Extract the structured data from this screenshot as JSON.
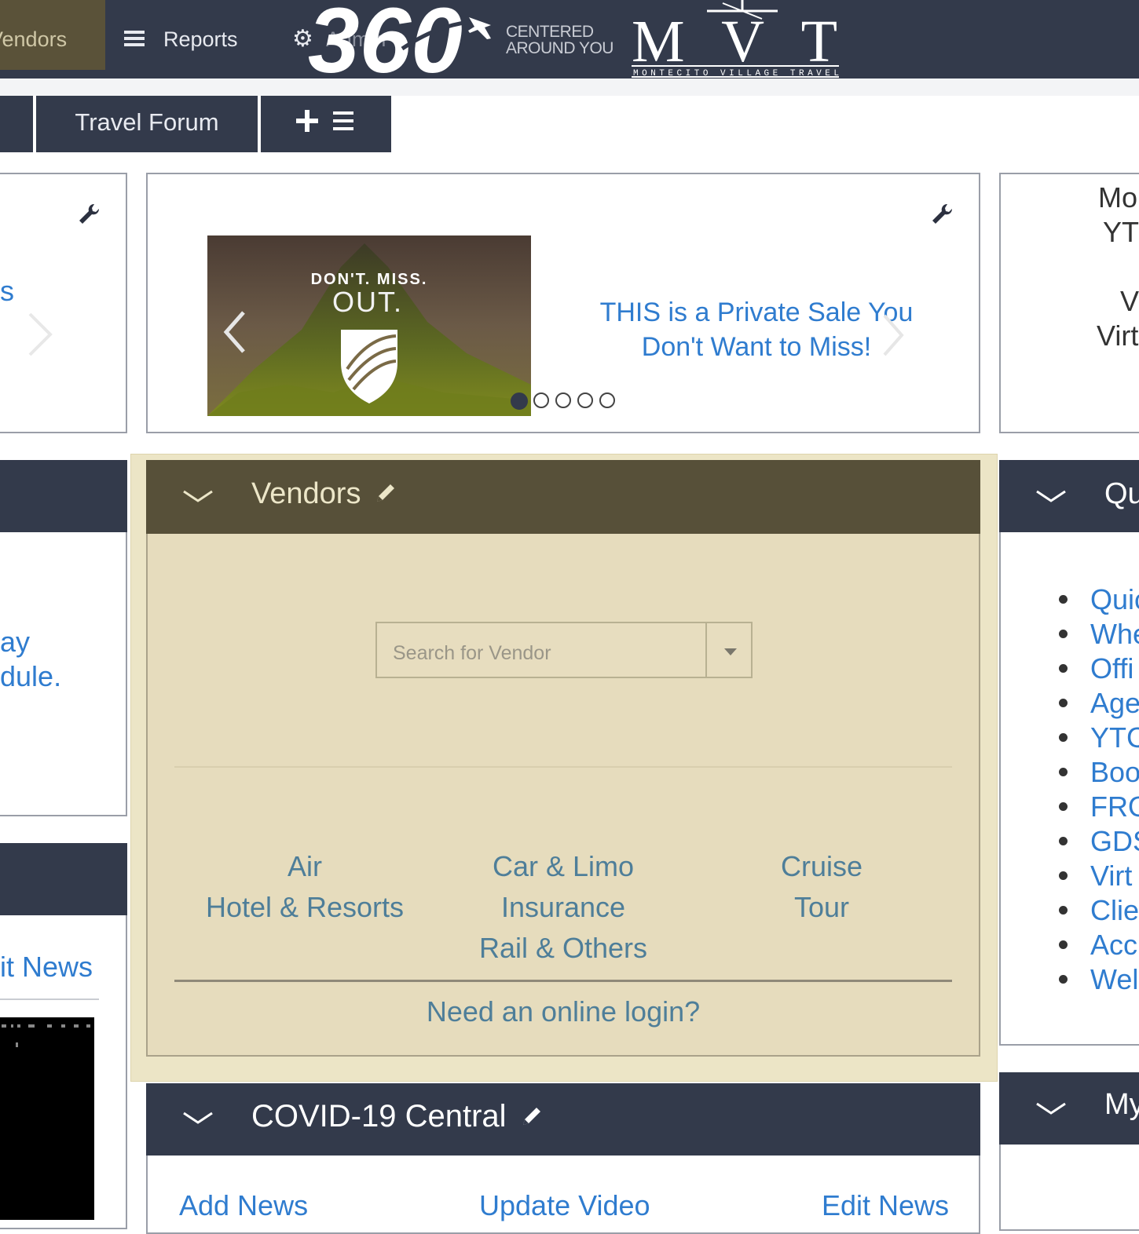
{
  "nav": {
    "vendors_label": "Vendors",
    "reports_label": "Reports",
    "admin_label": "Admin",
    "logo_text": "360",
    "tagline_line1": "CENTERED",
    "tagline_line2": "AROUND YOU",
    "brand_logo": "MVT",
    "brand_sub": "MONTECITO VILLAGE TRAVEL"
  },
  "tabs": {
    "travel_forum": "Travel Forum",
    "add_icon": "plus-icon",
    "list_icon": "list-icon"
  },
  "left_panel": {
    "partial_text": "s",
    "news_line1": "ay",
    "news_line2": "dule.",
    "bottom_link": "it News"
  },
  "carousel": {
    "image_line1": "DON'T. MISS.",
    "image_line2": "OUT.",
    "caption": "THIS is a Private Sale You Don't Want to Miss!",
    "slide_count": 5,
    "active_slide": 1
  },
  "right_panel": {
    "line1": "Mo",
    "line2": "YT",
    "line3": "V",
    "line4": "Virt"
  },
  "vendors": {
    "title": "Vendors",
    "search_placeholder": "Search for Vendor",
    "categories": {
      "air": "Air",
      "car_limo": "Car & Limo",
      "cruise": "Cruise",
      "hotel": "Hotel & Resorts",
      "insurance": "Insurance",
      "tour": "Tour",
      "rail": "Rail & Others"
    },
    "login_link": "Need an online login?"
  },
  "covid": {
    "title": "COVID-19 Central",
    "add_news": "Add News",
    "update_video": "Update Video",
    "edit_news": "Edit News"
  },
  "quick_links": {
    "title": "Qu",
    "items": [
      "Quic",
      "Whe",
      "Offi",
      "Age",
      "YTC",
      "Boo",
      "FRO",
      "GDS",
      "Virt",
      "Clie",
      "Acc",
      "Wel"
    ]
  },
  "my_panel": {
    "title": "My"
  },
  "colors": {
    "nav_bg": "#333a4b",
    "vendors_accent": "#575039",
    "vendors_body": "#e6dcbd",
    "link_blue": "#2f7ccf"
  }
}
